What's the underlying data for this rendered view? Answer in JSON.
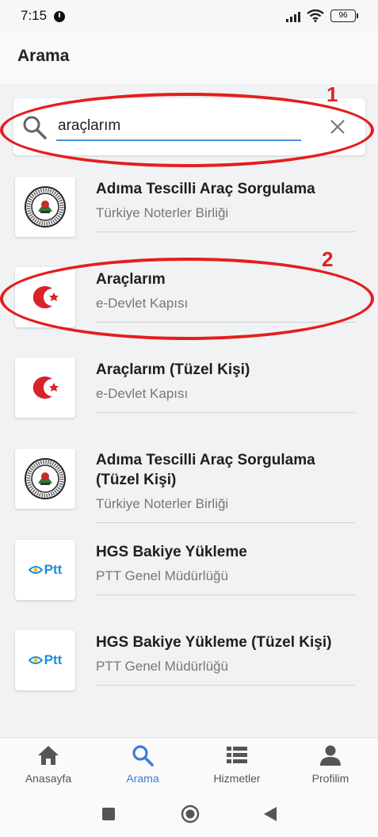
{
  "status_bar": {
    "time": "7:15",
    "battery": "96"
  },
  "header": {
    "title": "Arama"
  },
  "search": {
    "value": "araçlarım",
    "placeholder": ""
  },
  "annotations": {
    "marker_1": "1",
    "marker_2": "2",
    "color": "#e41e1e"
  },
  "results": [
    {
      "title": "Adıma Tescilli Araç Sorgulama",
      "subtitle": "Türkiye Noterler Birliği",
      "logo": "noterler-seal"
    },
    {
      "title": "Araçlarım",
      "subtitle": "e-Devlet Kapısı",
      "logo": "edevlet-logo"
    },
    {
      "title": "Araçlarım (Tüzel Kişi)",
      "subtitle": "e-Devlet Kapısı",
      "logo": "edevlet-logo"
    },
    {
      "title": "Adıma Tescilli Araç Sorgulama (Tüzel Kişi)",
      "subtitle": "Türkiye Noterler Birliği",
      "logo": "noterler-seal"
    },
    {
      "title": "HGS Bakiye Yükleme",
      "subtitle": "PTT Genel Müdürlüğü",
      "logo": "ptt-logo"
    },
    {
      "title": "HGS Bakiye Yükleme (Tüzel Kişi)",
      "subtitle": "PTT Genel Müdürlüğü",
      "logo": "ptt-logo"
    }
  ],
  "logos": {
    "ptt_text": "Ptt"
  },
  "bottom_nav": [
    {
      "label": "Anasayfa",
      "icon": "home-icon",
      "active": false
    },
    {
      "label": "Arama",
      "icon": "search-icon",
      "active": true
    },
    {
      "label": "Hizmetler",
      "icon": "list-icon",
      "active": false
    },
    {
      "label": "Profilim",
      "icon": "person-icon",
      "active": false
    }
  ],
  "colors": {
    "accent": "#3b7dd8",
    "edevlet_red": "#d8232a",
    "ptt_blue": "#1a8fd6",
    "ptt_yellow": "#f3b81b"
  }
}
